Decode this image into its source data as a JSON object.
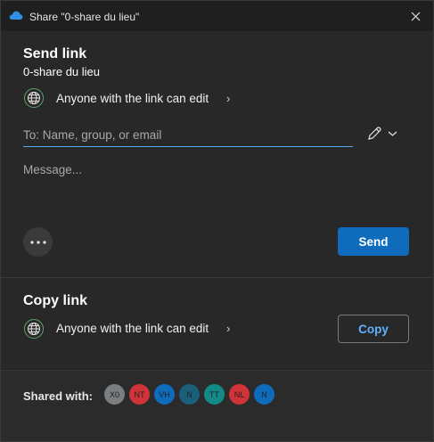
{
  "window": {
    "title": "Share \"0-share du lieu\""
  },
  "send": {
    "heading": "Send link",
    "item_name": "0-share du lieu",
    "permission": "Anyone with the link can edit",
    "to_placeholder": "To: Name, group, or email",
    "message_placeholder": "Message...",
    "send_label": "Send"
  },
  "copy": {
    "heading": "Copy link",
    "permission": "Anyone with the link can edit",
    "copy_label": "Copy"
  },
  "shared": {
    "label": "Shared with:",
    "people": [
      {
        "initials": "X0",
        "color": "#7a7e80"
      },
      {
        "initials": "NT",
        "color": "#d13438"
      },
      {
        "initials": "VH",
        "color": "#0f6cbd"
      },
      {
        "initials": "N",
        "color": "#1b5f7a"
      },
      {
        "initials": "TT",
        "color": "#138a87"
      },
      {
        "initials": "NL",
        "color": "#d13438"
      },
      {
        "initials": "N",
        "color": "#0f6cbd"
      }
    ]
  },
  "colors": {
    "accent": "#0f6cbd",
    "link_text": "#5fb2ff",
    "globe_ring": "#5ea36a"
  }
}
